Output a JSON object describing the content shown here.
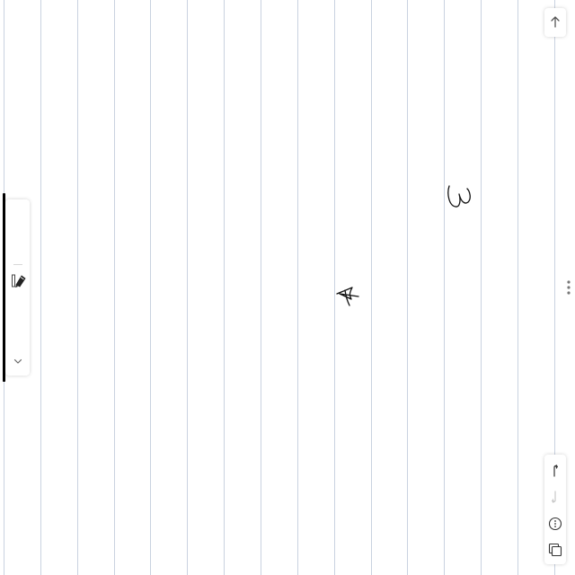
{
  "canvas": {
    "background": "#ffffff",
    "rule_color": "#c9d2e0",
    "ink_color": "#111111"
  },
  "handwriting": [
    {
      "glyph": "3"
    },
    {
      "glyph": "4"
    }
  ],
  "left_toolbar": {
    "accent_color": "#000000",
    "tools": [
      {
        "icon": "pen-icon",
        "active": true
      }
    ],
    "collapse_icon": "chevron-down-icon"
  },
  "top_right": {
    "icon": "arrow-up-icon"
  },
  "side_menu": {
    "icon": "kebab-icon"
  },
  "right_toolbar": {
    "buttons": [
      {
        "icon": "undo-icon",
        "enabled": true
      },
      {
        "icon": "redo-icon",
        "enabled": false
      },
      {
        "icon": "more-options-icon",
        "enabled": true
      },
      {
        "icon": "pages-icon",
        "enabled": true
      }
    ]
  }
}
